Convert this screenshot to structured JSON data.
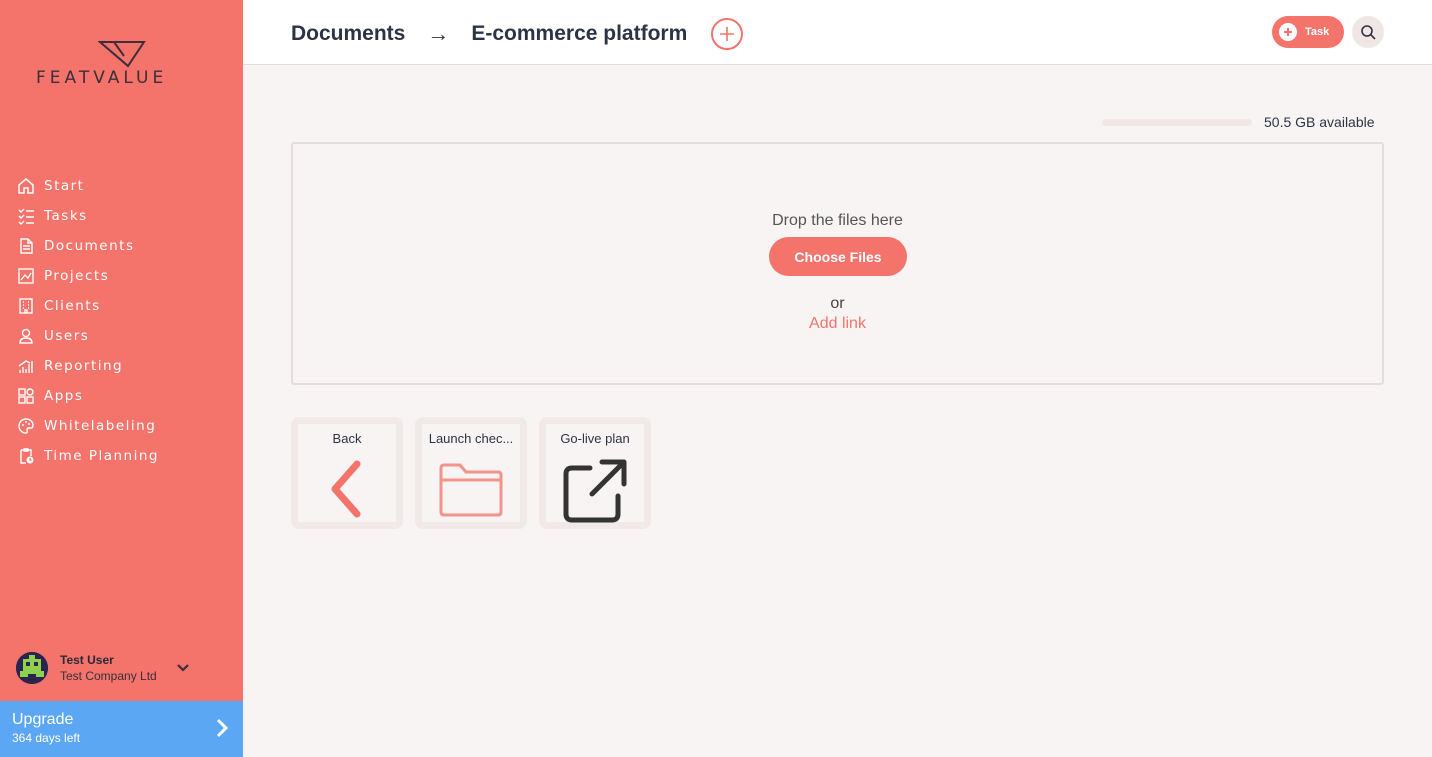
{
  "sidebar": {
    "logo_text": "FEATVALUE",
    "nav": [
      {
        "label": "Start",
        "icon": "home-icon"
      },
      {
        "label": "Tasks",
        "icon": "tasks-icon"
      },
      {
        "label": "Documents",
        "icon": "documents-icon"
      },
      {
        "label": "Projects",
        "icon": "projects-icon"
      },
      {
        "label": "Clients",
        "icon": "clients-icon"
      },
      {
        "label": "Users",
        "icon": "users-icon"
      },
      {
        "label": "Reporting",
        "icon": "reporting-icon"
      },
      {
        "label": "Apps",
        "icon": "apps-icon"
      },
      {
        "label": "Whitelabeling",
        "icon": "palette-icon"
      },
      {
        "label": "Time Planning",
        "icon": "time-planning-icon"
      }
    ],
    "user": {
      "name": "Test User",
      "company": "Test Company Ltd"
    },
    "upgrade": {
      "title": "Upgrade",
      "subtitle": "364 days left"
    }
  },
  "header": {
    "breadcrumb": [
      "Documents",
      "E-commerce platform"
    ],
    "arrow": "→",
    "task_button": "Task"
  },
  "main": {
    "storage": {
      "text": "50.5 GB available",
      "used_fraction": 0.0
    },
    "dropzone": {
      "drop_text": "Drop the files here",
      "choose_button": "Choose Files",
      "or_text": "or",
      "add_link": "Add link"
    },
    "tiles": [
      {
        "label": "Back",
        "icon": "chevron-left-icon"
      },
      {
        "label": "Launch chec...",
        "icon": "folder-icon"
      },
      {
        "label": "Go-live plan",
        "icon": "external-link-icon"
      }
    ]
  },
  "colors": {
    "accent": "#f4736b",
    "upgrade": "#5ba7f4",
    "text_dark": "#2d3346"
  }
}
